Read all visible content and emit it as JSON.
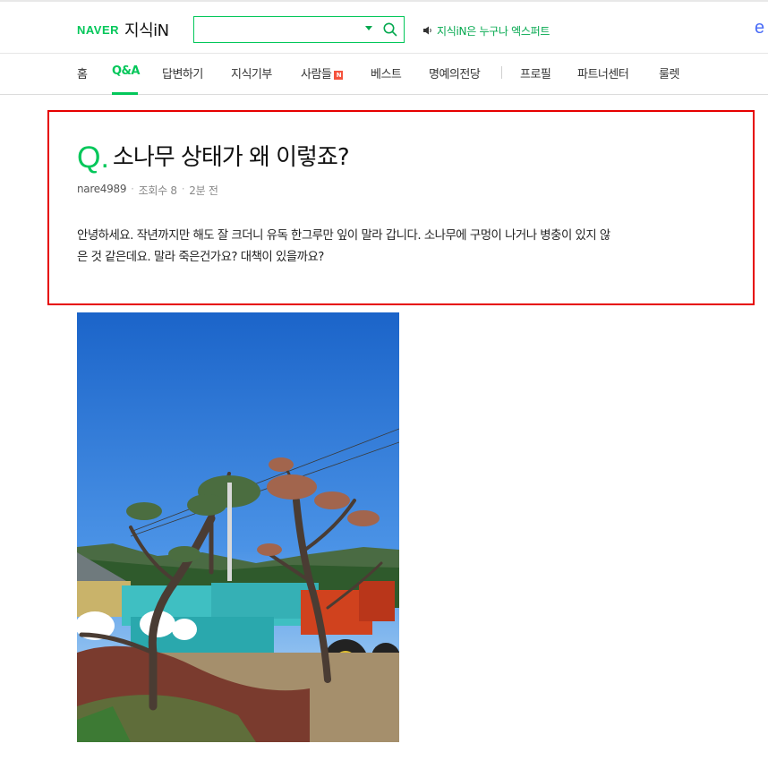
{
  "header": {
    "logo_brand": "NAVER",
    "logo_service": "지식iN",
    "search": {
      "value": "",
      "placeholder": ""
    },
    "notice": "지식iN은 누구나 엑스퍼트",
    "edge_text": "e"
  },
  "nav": {
    "items": [
      {
        "label": "홈",
        "active": false
      },
      {
        "label": "Q&A",
        "active": true
      },
      {
        "label": "답변하기",
        "active": false
      },
      {
        "label": "지식기부",
        "active": false
      },
      {
        "label": "사람들",
        "active": false,
        "badge": "N"
      },
      {
        "label": "베스트",
        "active": false
      },
      {
        "label": "명예의전당",
        "active": false
      },
      {
        "label": "프로필",
        "active": false
      },
      {
        "label": "파트너센터",
        "active": false
      },
      {
        "label": "룰렛",
        "active": false
      }
    ]
  },
  "question": {
    "mark": "Q.",
    "title": "소나무 상태가 왜 이렇죠?",
    "author": "nare4989",
    "views": "조회수 8",
    "time": "2분 전",
    "body_line1": "안녕하세요. 작년까지만 해도 잘 크더니 유독 한그루만 잎이 말라 갑니다. 소나무에 구멍이 나거나 병충이 있지 않",
    "body_line2": "은 것 같은데요. 말라 죽은건가요? 대책이 있을까요?"
  },
  "colors": {
    "accent": "#03c75a",
    "highlight_border": "#e60000",
    "badge": "#f5533d"
  },
  "icons": {
    "search": "search-icon",
    "dropdown": "caret-down-icon",
    "notice": "speaker-icon"
  }
}
